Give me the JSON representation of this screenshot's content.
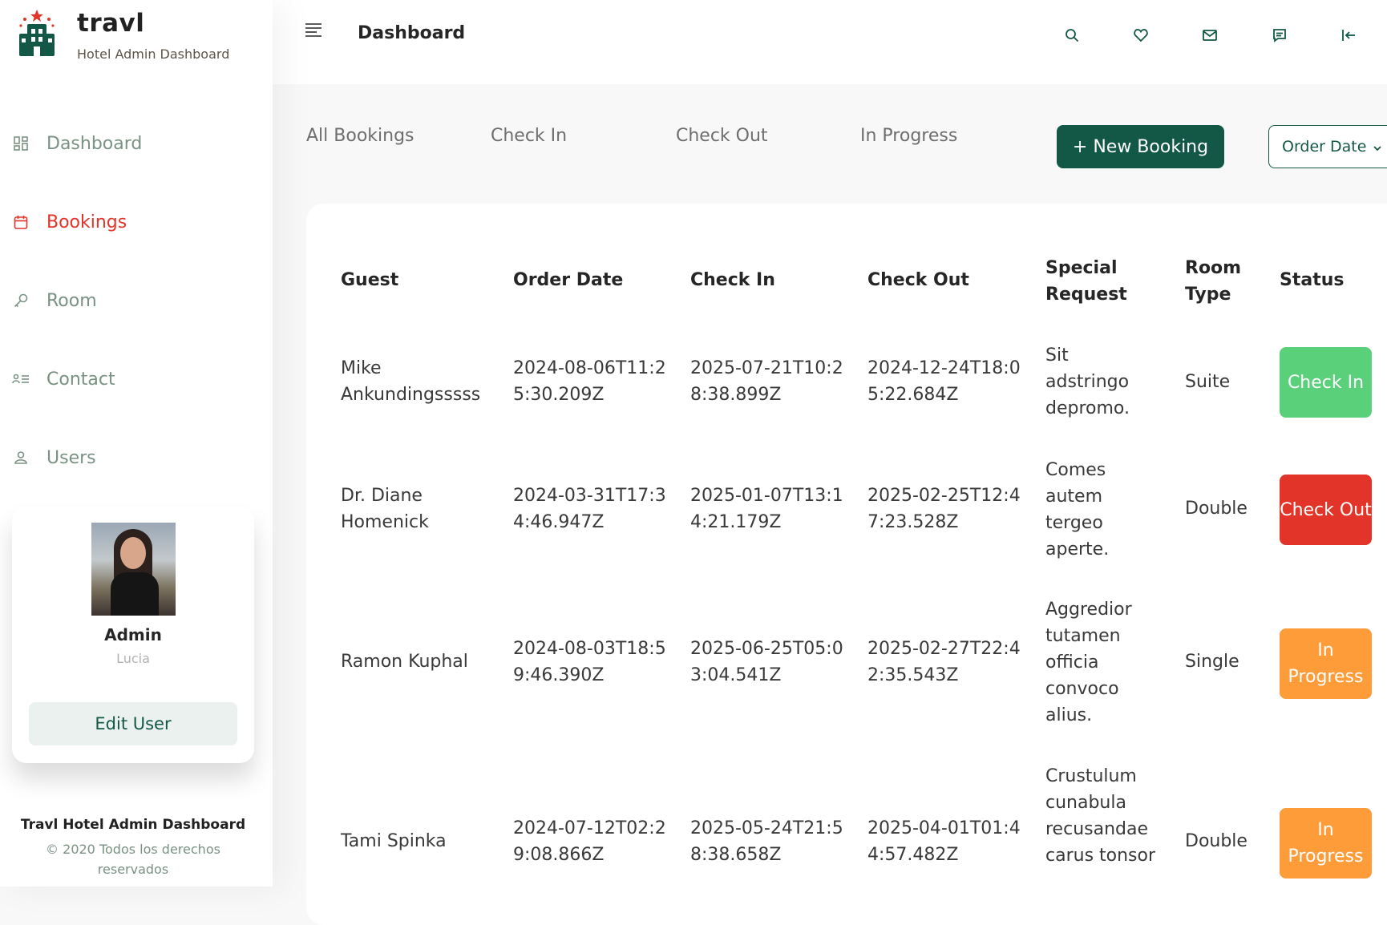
{
  "brand": {
    "name": "travl",
    "subtitle": "Hotel Admin Dashboard"
  },
  "colors": {
    "brand_green": "#135846",
    "active_red": "#e23428",
    "check_in": "#5ad07a",
    "check_out": "#e23428",
    "in_progress": "#ff9c3a",
    "nav_muted": "#799283"
  },
  "nav": [
    {
      "label": "Dashboard",
      "icon": "dashboard-grid-icon",
      "active": false
    },
    {
      "label": "Bookings",
      "icon": "calendar-icon",
      "active": true
    },
    {
      "label": "Room",
      "icon": "key-icon",
      "active": false
    },
    {
      "label": "Contact",
      "icon": "contact-list-icon",
      "active": false
    },
    {
      "label": "Users",
      "icon": "user-icon",
      "active": false
    }
  ],
  "user": {
    "name": "Admin",
    "subtitle": "Lucia",
    "edit_label": "Edit User"
  },
  "footer": {
    "title": "Travl Hotel Admin Dashboard",
    "copyright": "© 2020 Todos los derechos reservados"
  },
  "header": {
    "title": "Dashboard",
    "icons": [
      "menu-icon",
      "search-icon",
      "heart-icon",
      "mail-icon",
      "message-icon",
      "logout-icon"
    ]
  },
  "tabs": [
    "All Bookings",
    "Check In",
    "Check Out",
    "In Progress"
  ],
  "actions": {
    "new_booking": "+ New Booking",
    "order_select": "Order Date"
  },
  "table": {
    "columns": {
      "guest": "Guest",
      "order_date": "Order Date",
      "check_in": "Check In",
      "check_out": "Check Out",
      "special_request": "Special Request",
      "room_type": "Room Type",
      "status": "Status"
    },
    "rows": [
      {
        "guest": "Mike Ankundingsssss",
        "order_date": "2024-08-06T11:25:30.209Z",
        "check_in": "2025-07-21T10:28:38.899Z",
        "check_out": "2024-12-24T18:05:22.684Z",
        "special_request": "Sit adstringo depromo.",
        "room_type": "Suite",
        "status": "Check In"
      },
      {
        "guest": "Dr. Diane Homenick",
        "order_date": "2024-03-31T17:34:46.947Z",
        "check_in": "2025-01-07T13:14:21.179Z",
        "check_out": "2025-02-25T12:47:23.528Z",
        "special_request": "Comes autem tergeo aperte.",
        "room_type": "Double",
        "status": "Check Out"
      },
      {
        "guest": "Ramon Kuphal",
        "order_date": "2024-08-03T18:59:46.390Z",
        "check_in": "2025-06-25T05:03:04.541Z",
        "check_out": "2025-02-27T22:42:35.543Z",
        "special_request": "Aggredior tutamen officia convoco alius.",
        "room_type": "Single",
        "status": "In Progress"
      },
      {
        "guest": "Tami Spinka",
        "order_date": "2024-07-12T02:29:08.866Z",
        "check_in": "2025-05-24T21:58:38.658Z",
        "check_out": "2025-04-01T01:44:57.482Z",
        "special_request": "Crustulum cunabula recusandae carus tonsor",
        "room_type": "Double",
        "status": "In Progress"
      }
    ]
  }
}
